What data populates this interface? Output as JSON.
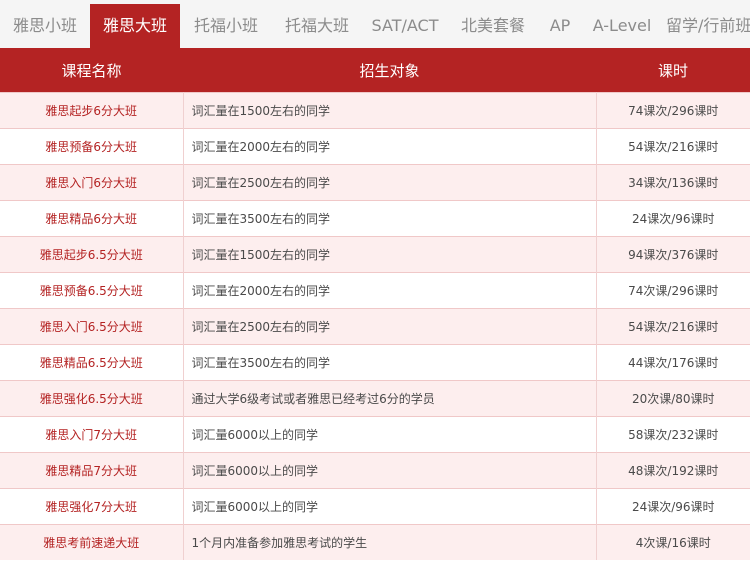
{
  "tabs": [
    {
      "label": "雅思小班",
      "active": false
    },
    {
      "label": "雅思大班",
      "active": true
    },
    {
      "label": "托福小班",
      "active": false
    },
    {
      "label": "托福大班",
      "active": false
    },
    {
      "label": "SAT/ACT",
      "active": false
    },
    {
      "label": "北美套餐",
      "active": false
    },
    {
      "label": "AP",
      "active": false
    },
    {
      "label": "A-Level",
      "active": false
    },
    {
      "label": "留学/行前班",
      "active": false
    }
  ],
  "table": {
    "headers": {
      "name": "课程名称",
      "target": "招生对象",
      "hours": "课时"
    },
    "rows": [
      {
        "name": "雅思起步6分大班",
        "target": "词汇量在1500左右的同学",
        "hours": "74课次/296课时"
      },
      {
        "name": "雅思预备6分大班",
        "target": "词汇量在2000左右的同学",
        "hours": "54课次/216课时"
      },
      {
        "name": "雅思入门6分大班",
        "target": "词汇量在2500左右的同学",
        "hours": "34课次/136课时"
      },
      {
        "name": "雅思精品6分大班",
        "target": "词汇量在3500左右的同学",
        "hours": "24课次/96课时"
      },
      {
        "name": "雅思起步6.5分大班",
        "target": "词汇量在1500左右的同学",
        "hours": "94课次/376课时"
      },
      {
        "name": "雅思预备6.5分大班",
        "target": "词汇量在2000左右的同学",
        "hours": "74次课/296课时"
      },
      {
        "name": "雅思入门6.5分大班",
        "target": "词汇量在2500左右的同学",
        "hours": "54课次/216课时"
      },
      {
        "name": "雅思精品6.5分大班",
        "target": "词汇量在3500左右的同学",
        "hours": "44课次/176课时"
      },
      {
        "name": "雅思强化6.5分大班",
        "target": "通过大学6级考试或者雅思已经考过6分的学员",
        "hours": "20次课/80课时"
      },
      {
        "name": "雅思入门7分大班",
        "target": "词汇量6000以上的同学",
        "hours": "58课次/232课时"
      },
      {
        "name": "雅思精品7分大班",
        "target": "词汇量6000以上的同学",
        "hours": "48课次/192课时"
      },
      {
        "name": "雅思强化7分大班",
        "target": "词汇量6000以上的同学",
        "hours": "24课次/96课时"
      },
      {
        "name": "雅思考前速递大班",
        "target": "1个月内准备参加雅思考试的学生",
        "hours": "4次课/16课时"
      }
    ]
  }
}
